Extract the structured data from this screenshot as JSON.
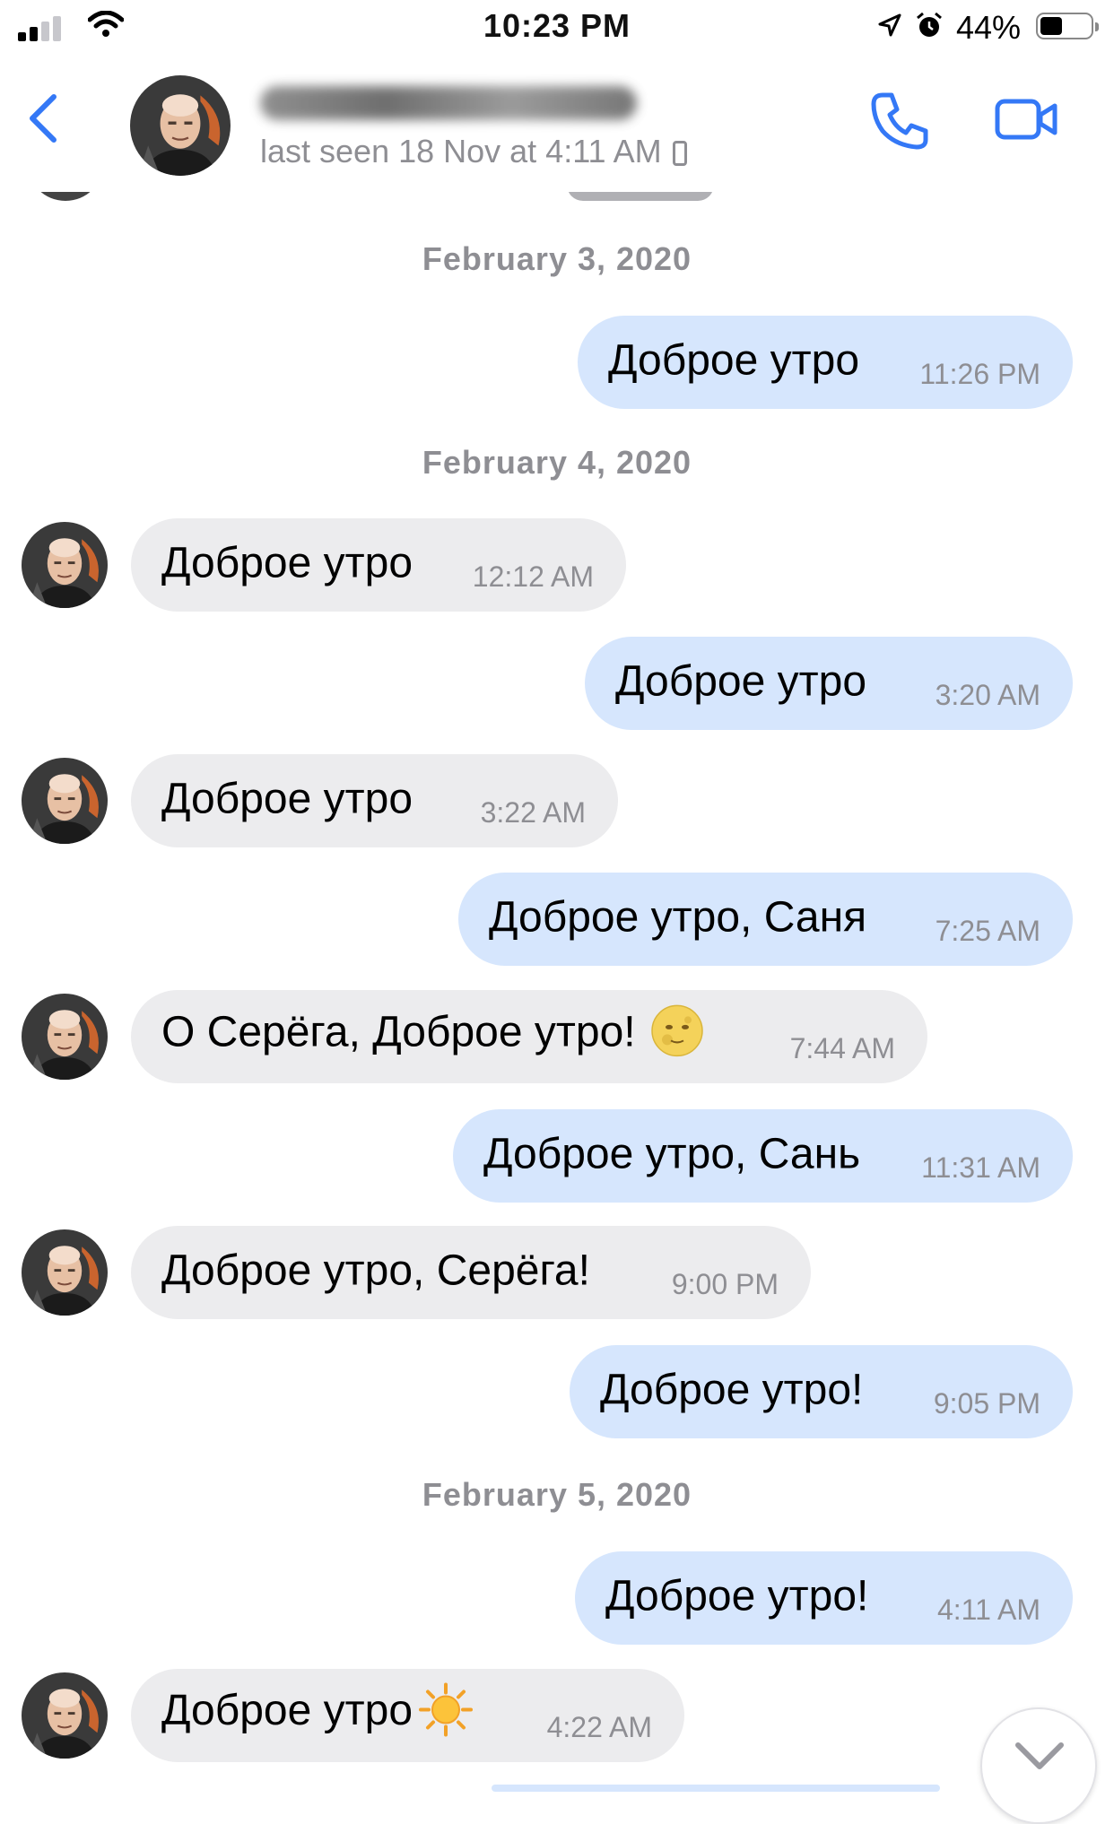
{
  "status_bar": {
    "time": "10:23 PM",
    "battery_percent": "44%",
    "battery_level": 0.44,
    "signal_bars": 2
  },
  "header": {
    "last_seen": "last seen 18 Nov at 4:11 AM",
    "back_icon": "chevron-left-icon",
    "call_icon": "phone-icon",
    "video_icon": "video-camera-icon",
    "accent_color": "#3478f6"
  },
  "colors": {
    "incoming_bubble": "#ececee",
    "outgoing_bubble": "#d6e6fd",
    "meta_text": "#8e8e93"
  },
  "chat": {
    "dates": [
      "February 3, 2020",
      "February 4, 2020",
      "February 5, 2020"
    ],
    "messages": [
      {
        "dir": "out",
        "text": "Доброе утро",
        "time": "11:26 PM"
      },
      {
        "dir": "in",
        "text": "Доброе утро",
        "time": "12:12 AM"
      },
      {
        "dir": "out",
        "text": "Доброе утро",
        "time": "3:20 AM"
      },
      {
        "dir": "in",
        "text": "Доброе утро",
        "time": "3:22 AM"
      },
      {
        "dir": "out",
        "text": "Доброе утро, Саня",
        "time": "7:25 AM"
      },
      {
        "dir": "in",
        "text": "О Серёга, Доброе утро!",
        "emoji": "full-moon-face",
        "time": "7:44 AM"
      },
      {
        "dir": "out",
        "text": "Доброе утро, Сань",
        "time": "11:31 AM"
      },
      {
        "dir": "in",
        "text": "Доброе утро, Серёга!",
        "time": "9:00 PM"
      },
      {
        "dir": "out",
        "text": "Доброе утро!",
        "time": "9:05 PM"
      },
      {
        "dir": "out",
        "text": "Доброе утро!",
        "time": "4:11 AM"
      },
      {
        "dir": "in",
        "text": "Доброе утро",
        "emoji": "sun",
        "time": "4:22 AM"
      }
    ]
  },
  "scroll_down_icon": "chevron-down-icon"
}
